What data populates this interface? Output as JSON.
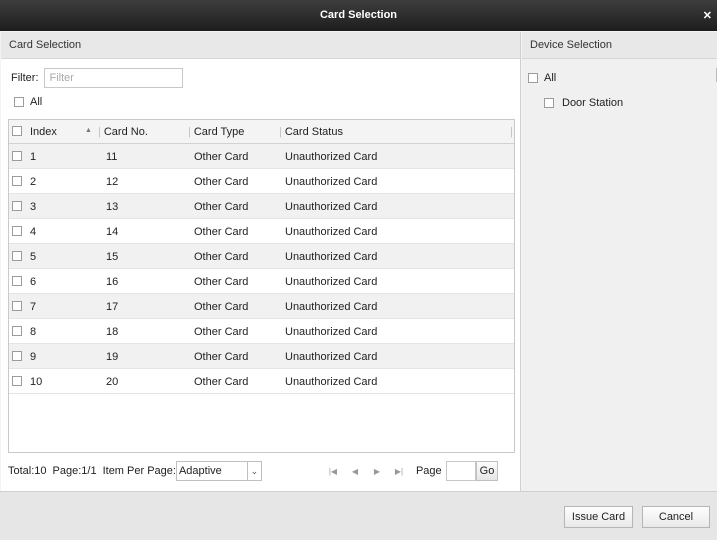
{
  "window": {
    "title": "Card Selection"
  },
  "left_panel": {
    "header": "Card Selection",
    "filter_label": "Filter:",
    "filter_placeholder": "Filter",
    "all_label": "All",
    "columns": [
      "Index",
      "Card No.",
      "Card Type",
      "Card Status"
    ],
    "rows": [
      {
        "index": "1",
        "card_no": "11",
        "card_type": "Other Card",
        "status": "Unauthorized Card"
      },
      {
        "index": "2",
        "card_no": "12",
        "card_type": "Other Card",
        "status": "Unauthorized Card"
      },
      {
        "index": "3",
        "card_no": "13",
        "card_type": "Other Card",
        "status": "Unauthorized Card"
      },
      {
        "index": "4",
        "card_no": "14",
        "card_type": "Other Card",
        "status": "Unauthorized Card"
      },
      {
        "index": "5",
        "card_no": "15",
        "card_type": "Other Card",
        "status": "Unauthorized Card"
      },
      {
        "index": "6",
        "card_no": "16",
        "card_type": "Other Card",
        "status": "Unauthorized Card"
      },
      {
        "index": "7",
        "card_no": "17",
        "card_type": "Other Card",
        "status": "Unauthorized Card"
      },
      {
        "index": "8",
        "card_no": "18",
        "card_type": "Other Card",
        "status": "Unauthorized Card"
      },
      {
        "index": "9",
        "card_no": "19",
        "card_type": "Other Card",
        "status": "Unauthorized Card"
      },
      {
        "index": "10",
        "card_no": "20",
        "card_type": "Other Card",
        "status": "Unauthorized Card"
      }
    ],
    "pager": {
      "total": "Total:10",
      "page_info": "Page:1/1",
      "items_per_page_label": "Item Per Page:",
      "items_per_page_value": "Adaptive",
      "page_label": "Page",
      "page_value": "",
      "go_label": "Go"
    }
  },
  "right_panel": {
    "header": "Device Selection",
    "all_label": "All",
    "devices": [
      "Door Station"
    ]
  },
  "footer": {
    "issue_card_label": "Issue Card",
    "cancel_label": "Cancel"
  },
  "icons": {
    "close": "close-icon",
    "sort": "sort-ascending-icon",
    "dropdown": "chevron-down-icon",
    "first_page": "first-page-icon",
    "prev_page": "prev-page-icon",
    "next_page": "next-page-icon",
    "last_page": "last-page-icon"
  }
}
